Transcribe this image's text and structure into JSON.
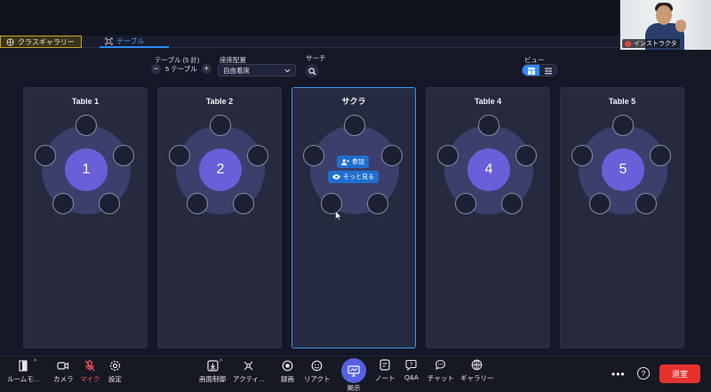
{
  "tabs": {
    "gallery_label": "クラスギャラリー",
    "table_label": "テーブル"
  },
  "video": {
    "name": "インストラクタ"
  },
  "controls": {
    "table_count_label": "テーブル (5 計)",
    "table_count_value": "5 テーブル",
    "minus": "−",
    "plus": "+",
    "seating_label": "座席配置",
    "seating_value": "自由着席",
    "search_label": "サーチ",
    "view_label": "ビュー"
  },
  "tables": [
    {
      "title": "Table 1",
      "number": "1"
    },
    {
      "title": "Table 2",
      "number": "2"
    },
    {
      "title": "サクラ",
      "number": "",
      "join_label": "参加",
      "watch_label": "そっと見る"
    },
    {
      "title": "Table 4",
      "number": "4"
    },
    {
      "title": "Table 5",
      "number": "5"
    }
  ],
  "bottombar": {
    "room_mode": "ルームモ...",
    "camera": "カメラ",
    "mic": "マイク",
    "settings": "設定",
    "screen_control": "画面制御",
    "activity": "アクティ...",
    "record": "録画",
    "reaction": "リアクト",
    "present": "掲示",
    "note": "ノート",
    "qa": "Q&A",
    "chat": "チャット",
    "gallery": "ギャラリー",
    "more": "•••",
    "help": "?",
    "leave": "退室"
  },
  "colors": {
    "accent": "#2f8cff",
    "table_number_bg": "#6a5fd8",
    "leave_bg": "#e5322f",
    "gallery_tab_border": "#c9a227"
  }
}
